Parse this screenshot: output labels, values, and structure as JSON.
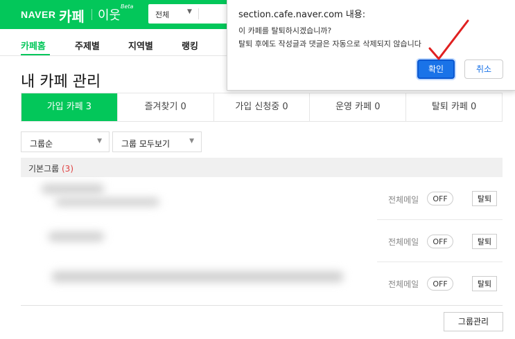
{
  "header": {
    "brand_naver": "NAVER",
    "brand_cafe": "카페",
    "neighbor": "이웃",
    "beta": "Beta",
    "search_scope": "전체"
  },
  "gnb": {
    "items": [
      "카페홈",
      "주제별",
      "지역별",
      "랭킹"
    ]
  },
  "page_title": "내 카페 관리",
  "tabs": [
    "가입 카페 3",
    "즐겨찾기 0",
    "가입 신청중 0",
    "운영 카페 0",
    "탈퇴 카페 0"
  ],
  "filters": {
    "sort": "그룹순",
    "group_view": "그룹 모두보기"
  },
  "group": {
    "name": "기본그룹",
    "count": "(3)"
  },
  "rows": [
    {
      "mail_label": "전체메일",
      "mail_state": "OFF",
      "leave_label": "탈퇴"
    },
    {
      "mail_label": "전체메일",
      "mail_state": "OFF",
      "leave_label": "탈퇴"
    },
    {
      "mail_label": "전체메일",
      "mail_state": "OFF",
      "leave_label": "탈퇴"
    }
  ],
  "group_manage_label": "그룹관리",
  "dialog": {
    "title": "section.cafe.naver.com 내용:",
    "message_line1": "이 카페를 탈퇴하시겠습니까?",
    "message_line2": "탈퇴 후에도 작성글과 댓글은 자동으로 삭제되지 않습니다",
    "ok_label": "확인",
    "cancel_label": "취소"
  },
  "colors": {
    "brand_green": "#03c75a",
    "primary_blue": "#1a73e8",
    "annotation_red": "#e02020",
    "count_red": "#e04040"
  }
}
